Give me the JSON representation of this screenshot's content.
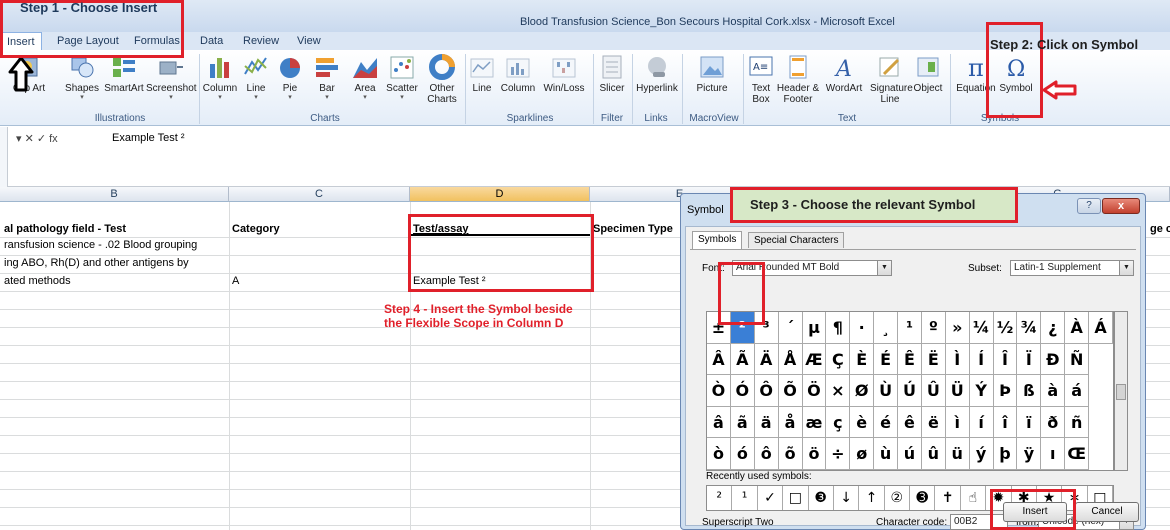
{
  "window": {
    "title": "Blood Transfusion Science_Bon Secours Hospital Cork.xlsx - Microsoft Excel"
  },
  "ribbon_tabs": [
    "Insert",
    "Page Layout",
    "Formulas",
    "Data",
    "Review",
    "View"
  ],
  "ribbon": {
    "illustrations": {
      "caption": "Illustrations",
      "buttons": [
        "Clip Art",
        "Shapes",
        "SmartArt",
        "Screenshot"
      ]
    },
    "charts": {
      "caption": "Charts",
      "buttons": [
        "Column",
        "Line",
        "Pie",
        "Bar",
        "Area",
        "Scatter",
        "Other Charts"
      ]
    },
    "sparklines": {
      "caption": "Sparklines",
      "buttons": [
        "Line",
        "Column",
        "Win/Loss"
      ]
    },
    "filter": {
      "caption": "Filter",
      "buttons": [
        "Slicer"
      ]
    },
    "links": {
      "caption": "Links",
      "buttons": [
        "Hyperlink"
      ]
    },
    "macroview": {
      "caption": "MacroView",
      "buttons": [
        "Picture"
      ]
    },
    "text": {
      "caption": "Text",
      "buttons": [
        "Text Box",
        "Header & Footer",
        "WordArt",
        "Signature Line",
        "Object"
      ]
    },
    "symbols": {
      "caption": "Symbols",
      "buttons": [
        "Equation",
        "Symbol"
      ]
    }
  },
  "formula_bar": {
    "fx_symbols": "▾  ✕ ✓ fx",
    "value": "Example Test ²"
  },
  "sheet": {
    "columns": [
      "B",
      "C",
      "D",
      "E",
      "F",
      "G"
    ],
    "header_row": {
      "b": "al pathology field - Test",
      "c": "Category",
      "d": "Test/assay",
      "e": "Specimen Type",
      "h": "ge c"
    },
    "rows": [
      {
        "b": "ransfusion science - .02 Blood grouping",
        "c": "",
        "d": ""
      },
      {
        "b": "ing ABO, Rh(D) and other antigens by",
        "c": "",
        "d": ""
      },
      {
        "b": "ated methods",
        "c": "A",
        "d": "Example Test ²"
      }
    ]
  },
  "annotations": {
    "step1": "Step 1 - Choose Insert",
    "step2": "Step 2: Click on Symbol",
    "step3": "Step 3 - Choose the relevant Symbol",
    "step4_line1": "Step 4 - Insert the Symbol beside",
    "step4_line2": "the Flexible Scope in Column D",
    "color": "#e0202a"
  },
  "symbol_dialog": {
    "title": "Symbol",
    "help": "?",
    "close": "x",
    "tabs": [
      "Symbols",
      "Special Characters"
    ],
    "font_label": "Font:",
    "font_value": "Arial Rounded MT Bold",
    "subset_label": "Subset:",
    "subset_value": "Latin-1 Supplement",
    "grid": [
      [
        "±",
        "²",
        "³",
        "´",
        "µ",
        "¶",
        "·",
        "¸",
        "¹",
        "º",
        "»",
        "¼",
        "½",
        "¾",
        "¿",
        "À",
        "Á"
      ],
      [
        "Â",
        "Ã",
        "Ä",
        "Å",
        "Æ",
        "Ç",
        "È",
        "É",
        "Ê",
        "Ë",
        "Ì",
        "Í",
        "Î",
        "Ï",
        "Ð",
        "Ñ"
      ],
      [
        "Ò",
        "Ó",
        "Ô",
        "Õ",
        "Ö",
        "×",
        "Ø",
        "Ù",
        "Ú",
        "Û",
        "Ü",
        "Ý",
        "Þ",
        "ß",
        "à",
        "á"
      ],
      [
        "â",
        "ã",
        "ä",
        "å",
        "æ",
        "ç",
        "è",
        "é",
        "ê",
        "ë",
        "ì",
        "í",
        "î",
        "ï",
        "ð",
        "ñ"
      ],
      [
        "ò",
        "ó",
        "ô",
        "õ",
        "ö",
        "÷",
        "ø",
        "ù",
        "ú",
        "û",
        "ü",
        "ý",
        "þ",
        "ÿ",
        "ı",
        "Œ"
      ]
    ],
    "selected_symbol": "²",
    "recent_label": "Recently used symbols:",
    "recent": [
      "²",
      "¹",
      "✓",
      "□",
      "❸",
      "↓",
      "↑",
      "②",
      "➌",
      "✝",
      "☝",
      "✹",
      "✱",
      "★",
      "∗",
      "□"
    ],
    "char_name": "Superscript Two",
    "code_label": "Character code:",
    "code_value": "00B2",
    "from_label": "from:",
    "from_value": "Unicode (hex)",
    "insert": "Insert",
    "cancel": "Cancel"
  }
}
